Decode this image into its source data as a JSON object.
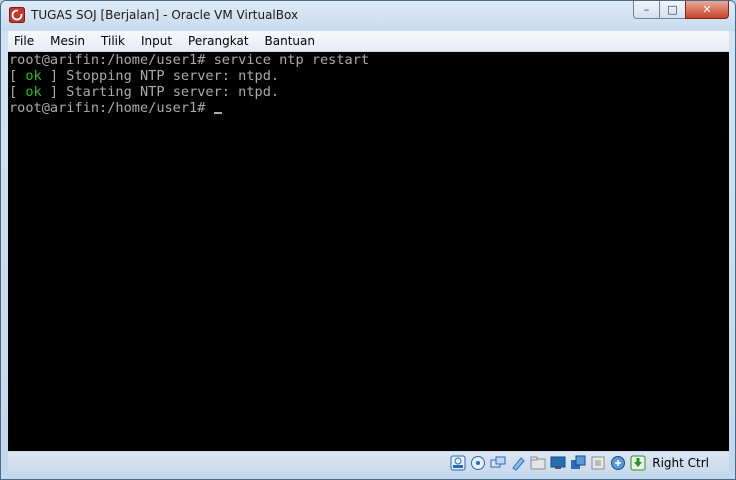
{
  "window": {
    "title": "TUGAS SOJ [Berjalan] - Oracle VM VirtualBox",
    "icon": "virtualbox-icon",
    "buttons": {
      "minimize_glyph": "–",
      "maximize_glyph": "□",
      "close_glyph": "✕"
    }
  },
  "menu": {
    "items": [
      "File",
      "Mesin",
      "Tilik",
      "Input",
      "Perangkat",
      "Bantuan"
    ]
  },
  "terminal": {
    "line1": "root@arifin:/home/user1# service ntp restart",
    "line2": {
      "open": "[ ",
      "ok": "ok",
      "rest": " ] Stopping NTP server: ntpd."
    },
    "line3": {
      "open": "[ ",
      "ok": "ok",
      "rest": " ] Starting NTP server: ntpd."
    },
    "prompt": "root@arifin:/home/user1# ",
    "colors": {
      "text": "#aaaaaa",
      "ok": "#2fb82f",
      "background": "#000000"
    }
  },
  "statusbar": {
    "icons": [
      "hard-disk-icon",
      "optical-drive-icon",
      "audio-icon",
      "network-icon",
      "shared-folders-icon",
      "display-icon",
      "video-capture-icon",
      "usb-icon",
      "mouse-integration-icon",
      "host-key-arrow-icon"
    ],
    "host_key": "Right Ctrl"
  }
}
